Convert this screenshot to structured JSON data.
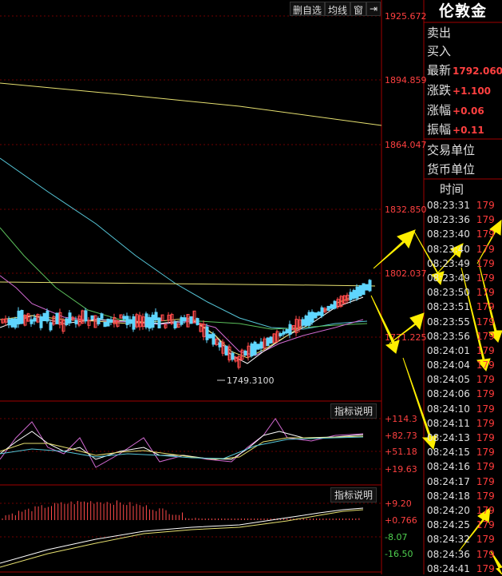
{
  "toolbar": {
    "select": "删自选",
    "avg": "均线",
    "window": "窗",
    "back": "⇥"
  },
  "panel": {
    "title": "伦敦金",
    "sell_label": "卖出",
    "buy_label": "买入",
    "latest_label": "最新",
    "latest_value": "1792.060",
    "change_label": "涨跌",
    "change_value": "+1.100",
    "pct_label": "涨幅",
    "pct_value": "+0.06",
    "amp_label": "振幅",
    "amp_value": "+0.11",
    "unit_label": "交易单位",
    "currency_label": "货币单位",
    "time_header": "时间"
  },
  "price_axis": [
    "1925.672",
    "1894.859",
    "1864.047",
    "1832.850",
    "1802.037",
    "1771.225"
  ],
  "low_label": "1749.3100",
  "ind1_axis": [
    "+114.3",
    "+82.73",
    "+51.18",
    "+19.63"
  ],
  "ind2_axis": [
    "+9.20",
    "+0.766",
    "-8.07",
    "-16.50"
  ],
  "ind_button": "指标说明",
  "ticks": [
    {
      "t": "08:23:31",
      "p": "179"
    },
    {
      "t": "08:23:36",
      "p": "179"
    },
    {
      "t": "08:23:40",
      "p": "179"
    },
    {
      "t": "08:23:40",
      "p": "179"
    },
    {
      "t": "08:23:49",
      "p": "179"
    },
    {
      "t": "08:23:49",
      "p": "179"
    },
    {
      "t": "08:23:50",
      "p": "179"
    },
    {
      "t": "08:23:51",
      "p": "179"
    },
    {
      "t": "08:23:55",
      "p": "179"
    },
    {
      "t": "08:23:56",
      "p": "179"
    },
    {
      "t": "08:24:01",
      "p": "179"
    },
    {
      "t": "08:24:04",
      "p": "179"
    },
    {
      "t": "08:24:05",
      "p": "179"
    },
    {
      "t": "08:24:06",
      "p": "179"
    },
    {
      "t": "08:24:10",
      "p": "179"
    },
    {
      "t": "08:24:11",
      "p": "179"
    },
    {
      "t": "08:24:13",
      "p": "179"
    },
    {
      "t": "08:24:15",
      "p": "179"
    },
    {
      "t": "08:24:16",
      "p": "179"
    },
    {
      "t": "08:24:17",
      "p": "179"
    },
    {
      "t": "08:24:18",
      "p": "179"
    },
    {
      "t": "08:24:20",
      "p": "179"
    },
    {
      "t": "08:24:25",
      "p": "179"
    },
    {
      "t": "08:24:32",
      "p": "179"
    },
    {
      "t": "08:24:36",
      "p": "179"
    },
    {
      "t": "08:24:41",
      "p": "179"
    }
  ]
}
